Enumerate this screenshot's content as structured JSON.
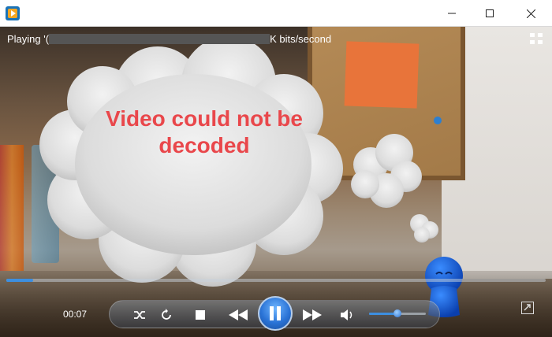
{
  "window": {
    "app_icon": "media-player-icon",
    "minimize_icon": "minimize-icon",
    "maximize_icon": "maximize-icon",
    "close_icon": "close-icon"
  },
  "status": {
    "prefix": "Playing '(",
    "suffix": "K bits/second"
  },
  "error": {
    "message": "Video could not be decoded"
  },
  "playback": {
    "current_time": "00:07",
    "progress_fraction": 0.05,
    "volume_fraction": 0.5
  },
  "controls": {
    "shuffle_icon": "shuffle-icon",
    "repeat_icon": "repeat-icon",
    "stop_icon": "stop-icon",
    "previous_icon": "previous-icon",
    "pause_icon": "pause-icon",
    "next_icon": "next-icon",
    "volume_icon": "volume-icon",
    "switch_layout_icon": "switch-layout-icon",
    "fullscreen_icon": "fullscreen-icon"
  },
  "colors": {
    "accent": "#3d8fe0",
    "error": "#e9474b"
  }
}
